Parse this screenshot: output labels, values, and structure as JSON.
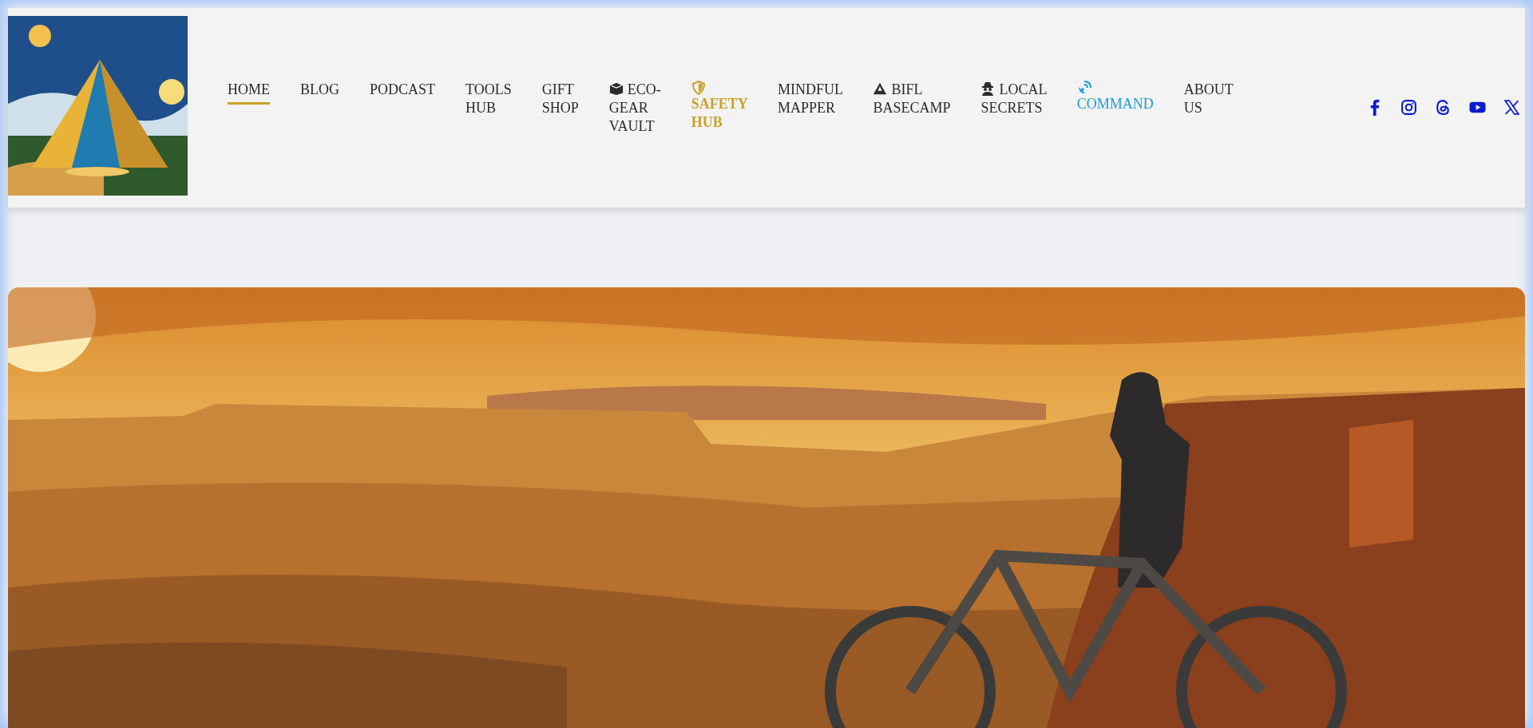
{
  "header": {
    "nav": [
      {
        "label": "HOME",
        "selected": true,
        "color": "#2b2b2b",
        "bold": false
      },
      {
        "label": "BLOG",
        "selected": false,
        "color": "#2b2b2b",
        "bold": false
      },
      {
        "label": "PODCAST",
        "selected": false,
        "color": "#2b2b2b",
        "bold": false
      },
      {
        "label": "TOOLS HUB",
        "selected": false,
        "color": "#2b2b2b",
        "bold": false
      },
      {
        "label": "GIFT SHOP",
        "selected": false,
        "color": "#2b2b2b",
        "bold": false
      },
      {
        "label": "ECO-GEAR VAULT",
        "selected": false,
        "color": "#2b2b2b",
        "bold": false
      },
      {
        "label": "SAFETY HUB",
        "selected": false,
        "color": "#c9a227",
        "bold": true
      },
      {
        "label": "MINDFUL MAPPER",
        "selected": false,
        "color": "#2b2b2b",
        "bold": false
      },
      {
        "label": "BIFL BASECAMP",
        "selected": false,
        "color": "#2b2b2b",
        "bold": false
      },
      {
        "label": "LOCAL SECRETS",
        "selected": false,
        "color": "#2b2b2b",
        "bold": false
      },
      {
        "label": "COMMAND",
        "selected": false,
        "color": "#1a9bd7",
        "bold": false
      },
      {
        "label": "ABOUT US",
        "selected": false,
        "color": "#2b2b2b",
        "bold": false
      }
    ]
  }
}
